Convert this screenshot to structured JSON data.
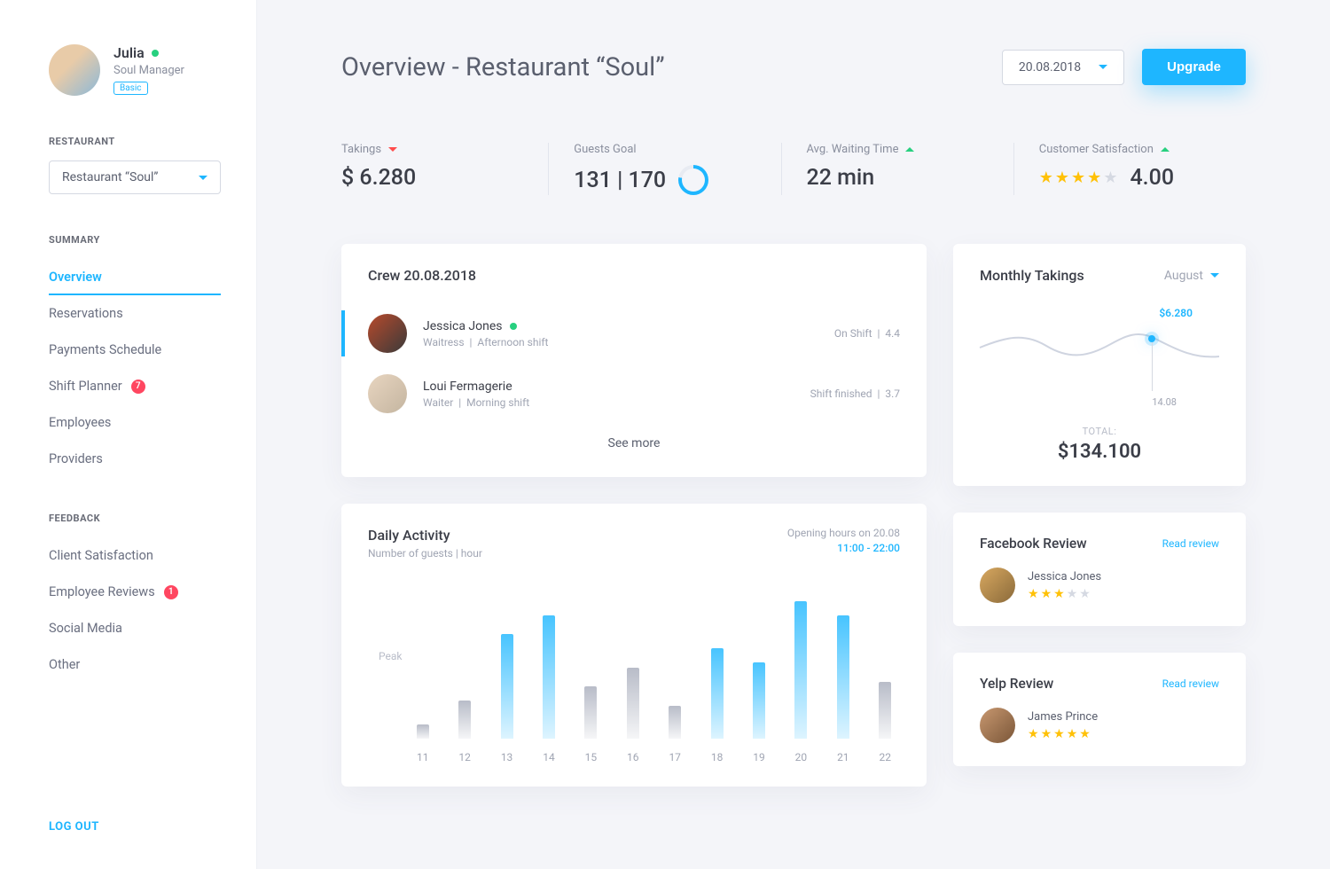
{
  "profile": {
    "name": "Julia",
    "role": "Soul Manager",
    "plan": "Basic"
  },
  "sidebar": {
    "restaurant_label": "RESTAURANT",
    "restaurant_selected": "Restaurant “Soul”",
    "summary_label": "SUMMARY",
    "summary_items": [
      {
        "label": "Overview",
        "badge": null,
        "active": true
      },
      {
        "label": "Reservations",
        "badge": null,
        "active": false
      },
      {
        "label": "Payments Schedule",
        "badge": null,
        "active": false
      },
      {
        "label": "Shift Planner",
        "badge": "7",
        "active": false
      },
      {
        "label": "Employees",
        "badge": null,
        "active": false
      },
      {
        "label": "Providers",
        "badge": null,
        "active": false
      }
    ],
    "feedback_label": "FEEDBACK",
    "feedback_items": [
      {
        "label": "Client Satisfaction",
        "badge": null
      },
      {
        "label": "Employee Reviews",
        "badge": "1"
      },
      {
        "label": "Social Media",
        "badge": null
      },
      {
        "label": "Other",
        "badge": null
      }
    ],
    "logout": "LOG OUT"
  },
  "header": {
    "title": "Overview - Restaurant “Soul”",
    "date": "20.08.2018",
    "upgrade": "Upgrade"
  },
  "metrics": {
    "takings": {
      "label": "Takings",
      "value": "$ 6.280",
      "trend": "down"
    },
    "guests": {
      "label": "Guests Goal",
      "value": "131 | 170"
    },
    "waiting": {
      "label": "Avg. Waiting Time",
      "value": "22 min",
      "trend": "up"
    },
    "satisfaction": {
      "label": "Customer Satisfaction",
      "value": "4.00",
      "stars": 4,
      "trend": "up"
    }
  },
  "crew": {
    "title": "Crew 20.08.2018",
    "members": [
      {
        "name": "Jessica Jones",
        "online": true,
        "role": "Waitress",
        "shift": "Afternoon shift",
        "status": "On Shift",
        "rating": "4.4"
      },
      {
        "name": "Loui Fermagerie",
        "online": false,
        "role": "Waiter",
        "shift": "Morning shift",
        "status": "Shift finished",
        "rating": "3.7"
      }
    ],
    "see_more": "See more"
  },
  "daily": {
    "title": "Daily Activity",
    "subtitle": "Number of guests | hour",
    "opening_label": "Opening hours on 20.08",
    "hours": "11:00 - 22:00",
    "peak_label": "Peak"
  },
  "monthly": {
    "title": "Monthly Takings",
    "month": "August",
    "highlight_value": "$6.280",
    "highlight_date": "14.08",
    "total_label": "TOTAL:",
    "total": "$134.100"
  },
  "reviews": [
    {
      "source": "Facebook Review",
      "link": "Read review",
      "name": "Jessica Jones",
      "stars": 3
    },
    {
      "source": "Yelp Review",
      "link": "Read review",
      "name": "James Prince",
      "stars": 5
    }
  ],
  "chart_data": {
    "type": "bar",
    "title": "Daily Activity — Number of guests per hour",
    "xlabel": "hour",
    "ylabel": "guests",
    "peak_reference": 100,
    "categories": [
      "11",
      "12",
      "13",
      "14",
      "15",
      "16",
      "17",
      "18",
      "19",
      "20",
      "21",
      "22"
    ],
    "values": [
      15,
      40,
      110,
      130,
      55,
      75,
      35,
      95,
      80,
      145,
      130,
      60
    ],
    "colors_by_bar": [
      "muted",
      "muted",
      "accent",
      "accent",
      "muted",
      "muted",
      "muted",
      "accent",
      "accent",
      "accent",
      "accent",
      "muted"
    ]
  }
}
